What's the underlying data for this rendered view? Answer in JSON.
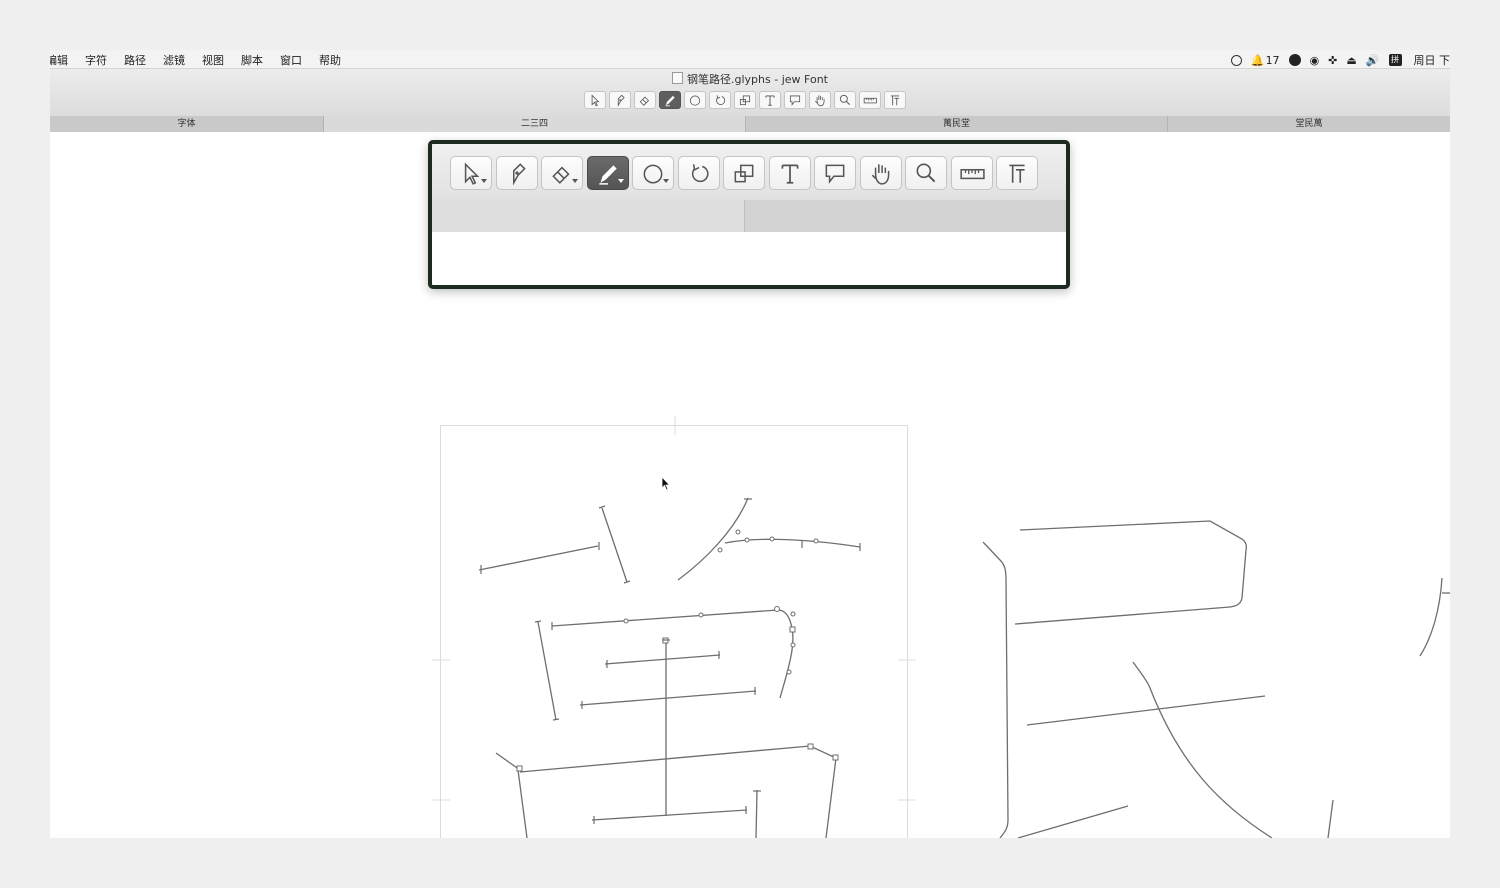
{
  "menubar": {
    "items": [
      "编辑",
      "字符",
      "路径",
      "滤镜",
      "视图",
      "脚本",
      "窗口",
      "帮助"
    ],
    "status": {
      "notification_count": "17",
      "clock": "周日 下"
    }
  },
  "window": {
    "title": "钢笔路径.glyphs - jew Font"
  },
  "tabs": [
    "字体",
    "二三四",
    "萬民堂",
    "堂民萬"
  ],
  "toolbar": {
    "tools": [
      {
        "icon": "select-arrow-icon",
        "glyph": "↖",
        "active": false
      },
      {
        "icon": "draw-pen-icon",
        "glyph": "✎",
        "active": false
      },
      {
        "icon": "eraser-icon",
        "glyph": "◇",
        "active": false
      },
      {
        "icon": "pencil-icon",
        "glyph": "✎",
        "active": true
      },
      {
        "icon": "primitives-circle-icon",
        "glyph": "◯",
        "active": false
      },
      {
        "icon": "rotate-icon",
        "glyph": "↺",
        "active": false
      },
      {
        "icon": "scale-icon",
        "glyph": "⧉",
        "active": false
      },
      {
        "icon": "text-icon",
        "glyph": "T",
        "active": false
      },
      {
        "icon": "annotation-icon",
        "glyph": "💬",
        "active": false
      },
      {
        "icon": "hand-icon",
        "glyph": "✋",
        "active": false
      },
      {
        "icon": "zoom-icon",
        "glyph": "⚲",
        "active": false
      },
      {
        "icon": "measure-icon",
        "glyph": "▭",
        "active": false
      },
      {
        "icon": "metrics-text-icon",
        "glyph": "T",
        "active": false
      }
    ]
  },
  "colors": {
    "accent_active": "#5e5e5e",
    "outline": "#6e6e6e",
    "callout_border": "#1c2a20"
  }
}
